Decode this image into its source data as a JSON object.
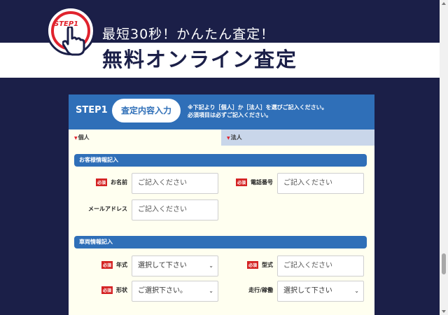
{
  "hero": {
    "badge_label": "STEP1",
    "subtitle": "最短30秒！かんたん査定！",
    "title": "無料オンライン査定"
  },
  "form": {
    "step_label": "STEP1",
    "pill_label": "査定内容入力",
    "note_line1": "※下記より［個人］か［法人］を選びご記入ください。",
    "note_line2": "必須項目は必ずご記入ください。",
    "tabs": [
      {
        "label": "個人",
        "active": true
      },
      {
        "label": "法人",
        "active": false
      }
    ],
    "required_tag": "必須",
    "customer_section": {
      "title": "お客様情報記入",
      "name_label": "お名前",
      "name_placeholder": "ご記入ください",
      "phone_label": "電話番号",
      "phone_placeholder": "ご記入ください",
      "email_label": "メールアドレス",
      "email_placeholder": "ご記入ください"
    },
    "vehicle_section": {
      "title": "車両情報記入",
      "year_label": "年式",
      "year_value": "選択して下さい",
      "model_label": "型式",
      "model_placeholder": "ご記入ください",
      "shape_label": "形状",
      "shape_value": "ご選択下さい。",
      "mileage_label": "走行/稼働",
      "mileage_value": "選択して下さい"
    }
  },
  "colors": {
    "background": "#1b1f48",
    "accent_blue": "#2f6fb8",
    "required_red": "#d42222",
    "card_bg": "#fffff0"
  }
}
